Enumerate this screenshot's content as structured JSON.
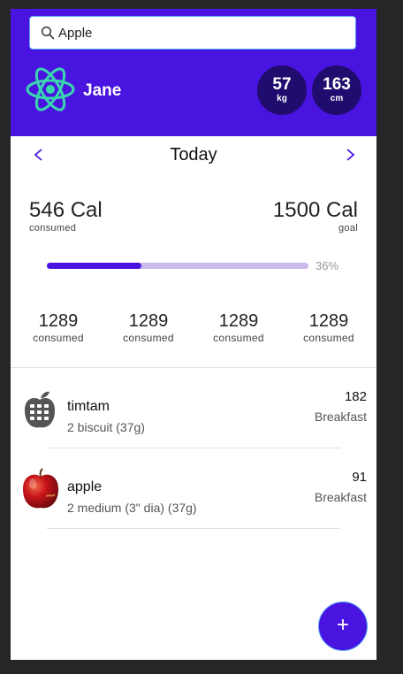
{
  "search": {
    "value": "Apple",
    "placeholder": ""
  },
  "user": {
    "name": "Jane"
  },
  "stats": {
    "weight": {
      "value": "57",
      "unit": "kg"
    },
    "height": {
      "value": "163",
      "unit": "cm"
    }
  },
  "day_nav": {
    "title": "Today",
    "prev": "<",
    "next": ">"
  },
  "calories": {
    "consumed": {
      "value": "546 Cal",
      "label": "consumed"
    },
    "goal": {
      "value": "1500 Cal",
      "label": "goal"
    },
    "progress_percent": 36,
    "progress_label": "36%"
  },
  "macros": [
    {
      "value": "1289",
      "label": "consumed"
    },
    {
      "value": "1289",
      "label": "consumed"
    },
    {
      "value": "1289",
      "label": "consumed"
    },
    {
      "value": "1289",
      "label": "consumed"
    }
  ],
  "foods": [
    {
      "name": "timtam",
      "portion": "2 biscuit (37g)",
      "calories": "182",
      "meal": "Breakfast",
      "icon": "generic-food-icon"
    },
    {
      "name": "apple",
      "portion": "2 medium (3\" dia) (37g)",
      "calories": "91",
      "meal": "Breakfast",
      "icon": "apple-photo"
    }
  ],
  "fab": {
    "label": "+"
  },
  "colors": {
    "accent": "#4a14e0",
    "stat_circle": "#1f0c6e",
    "progress_track": "#cbb9ee",
    "focus": "#59a7ff"
  }
}
